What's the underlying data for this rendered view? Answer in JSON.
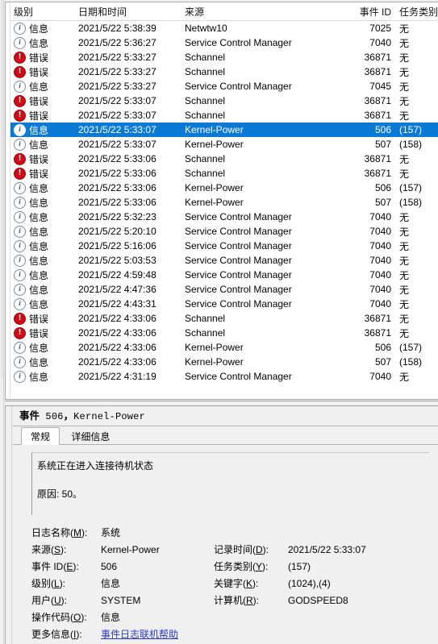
{
  "list": {
    "columns": [
      {
        "key": "level",
        "label": "级别",
        "align": "left"
      },
      {
        "key": "datetime",
        "label": "日期和时间",
        "align": "left"
      },
      {
        "key": "source",
        "label": "来源",
        "align": "left"
      },
      {
        "key": "event_id",
        "label": "事件 ID",
        "align": "right"
      },
      {
        "key": "task",
        "label": "任务类别",
        "align": "left"
      }
    ],
    "level_labels": {
      "info": "信息",
      "error": "错误"
    },
    "rows": [
      {
        "level": "info",
        "level_label": "信息",
        "datetime": "2021/5/22 5:38:39",
        "source": "Netwtw10",
        "event_id": "7025",
        "task": "无",
        "selected": false
      },
      {
        "level": "info",
        "level_label": "信息",
        "datetime": "2021/5/22 5:36:27",
        "source": "Service Control Manager",
        "event_id": "7040",
        "task": "无",
        "selected": false
      },
      {
        "level": "error",
        "level_label": "错误",
        "datetime": "2021/5/22 5:33:27",
        "source": "Schannel",
        "event_id": "36871",
        "task": "无",
        "selected": false
      },
      {
        "level": "error",
        "level_label": "错误",
        "datetime": "2021/5/22 5:33:27",
        "source": "Schannel",
        "event_id": "36871",
        "task": "无",
        "selected": false
      },
      {
        "level": "info",
        "level_label": "信息",
        "datetime": "2021/5/22 5:33:27",
        "source": "Service Control Manager",
        "event_id": "7045",
        "task": "无",
        "selected": false
      },
      {
        "level": "error",
        "level_label": "错误",
        "datetime": "2021/5/22 5:33:07",
        "source": "Schannel",
        "event_id": "36871",
        "task": "无",
        "selected": false
      },
      {
        "level": "error",
        "level_label": "错误",
        "datetime": "2021/5/22 5:33:07",
        "source": "Schannel",
        "event_id": "36871",
        "task": "无",
        "selected": false
      },
      {
        "level": "info",
        "level_label": "信息",
        "datetime": "2021/5/22 5:33:07",
        "source": "Kernel-Power",
        "event_id": "506",
        "task": "(157)",
        "selected": true
      },
      {
        "level": "info",
        "level_label": "信息",
        "datetime": "2021/5/22 5:33:07",
        "source": "Kernel-Power",
        "event_id": "507",
        "task": "(158)",
        "selected": false
      },
      {
        "level": "error",
        "level_label": "错误",
        "datetime": "2021/5/22 5:33:06",
        "source": "Schannel",
        "event_id": "36871",
        "task": "无",
        "selected": false
      },
      {
        "level": "error",
        "level_label": "错误",
        "datetime": "2021/5/22 5:33:06",
        "source": "Schannel",
        "event_id": "36871",
        "task": "无",
        "selected": false
      },
      {
        "level": "info",
        "level_label": "信息",
        "datetime": "2021/5/22 5:33:06",
        "source": "Kernel-Power",
        "event_id": "506",
        "task": "(157)",
        "selected": false
      },
      {
        "level": "info",
        "level_label": "信息",
        "datetime": "2021/5/22 5:33:06",
        "source": "Kernel-Power",
        "event_id": "507",
        "task": "(158)",
        "selected": false
      },
      {
        "level": "info",
        "level_label": "信息",
        "datetime": "2021/5/22 5:32:23",
        "source": "Service Control Manager",
        "event_id": "7040",
        "task": "无",
        "selected": false
      },
      {
        "level": "info",
        "level_label": "信息",
        "datetime": "2021/5/22 5:20:10",
        "source": "Service Control Manager",
        "event_id": "7040",
        "task": "无",
        "selected": false
      },
      {
        "level": "info",
        "level_label": "信息",
        "datetime": "2021/5/22 5:16:06",
        "source": "Service Control Manager",
        "event_id": "7040",
        "task": "无",
        "selected": false
      },
      {
        "level": "info",
        "level_label": "信息",
        "datetime": "2021/5/22 5:03:53",
        "source": "Service Control Manager",
        "event_id": "7040",
        "task": "无",
        "selected": false
      },
      {
        "level": "info",
        "level_label": "信息",
        "datetime": "2021/5/22 4:59:48",
        "source": "Service Control Manager",
        "event_id": "7040",
        "task": "无",
        "selected": false
      },
      {
        "level": "info",
        "level_label": "信息",
        "datetime": "2021/5/22 4:47:36",
        "source": "Service Control Manager",
        "event_id": "7040",
        "task": "无",
        "selected": false
      },
      {
        "level": "info",
        "level_label": "信息",
        "datetime": "2021/5/22 4:43:31",
        "source": "Service Control Manager",
        "event_id": "7040",
        "task": "无",
        "selected": false
      },
      {
        "level": "error",
        "level_label": "错误",
        "datetime": "2021/5/22 4:33:06",
        "source": "Schannel",
        "event_id": "36871",
        "task": "无",
        "selected": false
      },
      {
        "level": "error",
        "level_label": "错误",
        "datetime": "2021/5/22 4:33:06",
        "source": "Schannel",
        "event_id": "36871",
        "task": "无",
        "selected": false
      },
      {
        "level": "info",
        "level_label": "信息",
        "datetime": "2021/5/22 4:33:06",
        "source": "Kernel-Power",
        "event_id": "506",
        "task": "(157)",
        "selected": false
      },
      {
        "level": "info",
        "level_label": "信息",
        "datetime": "2021/5/22 4:33:06",
        "source": "Kernel-Power",
        "event_id": "507",
        "task": "(158)",
        "selected": false
      },
      {
        "level": "info",
        "level_label": "信息",
        "datetime": "2021/5/22 4:31:19",
        "source": "Service Control Manager",
        "event_id": "7040",
        "task": "无",
        "selected": false
      }
    ]
  },
  "detail": {
    "title_prefix": "事件",
    "title_id": "506",
    "title_sep": "，",
    "title_source": "Kernel-Power",
    "tabs": [
      {
        "label": "常规",
        "active": true
      },
      {
        "label": "详细信息",
        "active": false
      }
    ],
    "description_line1": "系统正在进入连接待机状态",
    "description_line2": "原因: 50。",
    "properties": {
      "log_name_label": "日志名称(M):",
      "log_name_accel": "M",
      "log_name_value": "系统",
      "source_label": "来源(S):",
      "source_accel": "S",
      "source_value": "Kernel-Power",
      "logged_label": "记录时间(D):",
      "logged_accel": "D",
      "logged_value": "2021/5/22 5:33:07",
      "event_id_label": "事件 ID(E):",
      "event_id_accel": "E",
      "event_id_value": "506",
      "task_label": "任务类别(Y):",
      "task_accel": "Y",
      "task_value": "(157)",
      "level_label": "级别(L):",
      "level_accel": "L",
      "level_value": "信息",
      "keywords_label": "关键字(K):",
      "keywords_accel": "K",
      "keywords_value": "(1024),(4)",
      "user_label": "用户(U):",
      "user_accel": "U",
      "user_value": "SYSTEM",
      "computer_label": "计算机(R):",
      "computer_accel": "R",
      "computer_value": "GODSPEED8",
      "opcode_label": "操作代码(O):",
      "opcode_accel": "O",
      "opcode_value": "信息",
      "more_info_label": "更多信息(I):",
      "more_info_accel": "I",
      "more_info_link": "事件日志联机帮助"
    }
  },
  "colors": {
    "selection": "#0a7ad4",
    "error_icon": "#cf0a16",
    "link": "#2b37c8",
    "chrome": "#f0f0f0"
  }
}
